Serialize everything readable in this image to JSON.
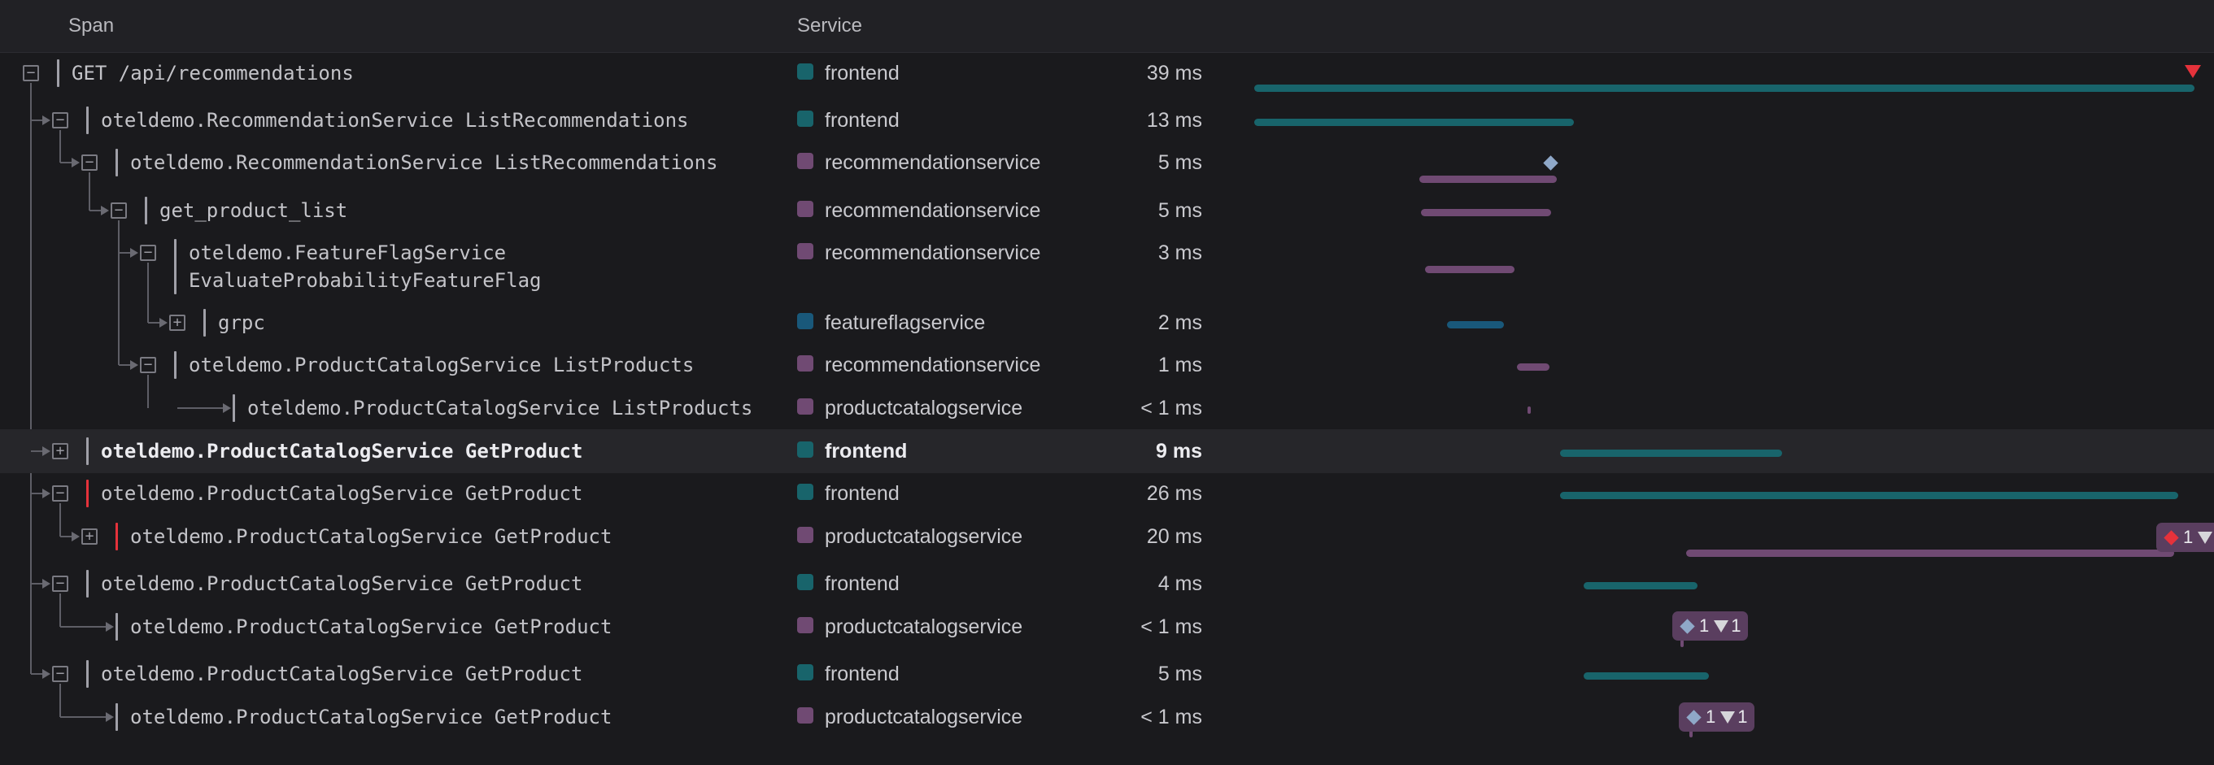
{
  "header": {
    "span_label": "Span",
    "service_label": "Service"
  },
  "colors": {
    "frontend": "#18646b",
    "recommendationservice": "#704a73",
    "featureflagservice": "#19587a",
    "productcatalogservice": "#704a73",
    "error": "#e5323b",
    "event_diamond": "#8fa8c8"
  },
  "rows": [
    {
      "name": "GET /api/recommendations",
      "service": "frontend",
      "duration": "39 ms",
      "expanded": true
    },
    {
      "name": "oteldemo.RecommendationService ListRecommendations",
      "service": "frontend",
      "duration": "13 ms",
      "expanded": true
    },
    {
      "name": "oteldemo.RecommendationService ListRecommendations",
      "service": "recommendationservice",
      "duration": "5 ms",
      "expanded": true
    },
    {
      "name": "get_product_list",
      "service": "recommendationservice",
      "duration": "5 ms",
      "expanded": true
    },
    {
      "name": "oteldemo.FeatureFlagService",
      "name_line2": "EvaluateProbabilityFeatureFlag",
      "service": "recommendationservice",
      "duration": "3 ms",
      "expanded": true
    },
    {
      "name": "grpc",
      "service": "featureflagservice",
      "duration": "2 ms",
      "expanded": false
    },
    {
      "name": "oteldemo.ProductCatalogService ListProducts",
      "service": "recommendationservice",
      "duration": "1 ms",
      "expanded": true
    },
    {
      "name": "oteldemo.ProductCatalogService ListProducts",
      "service": "productcatalogservice",
      "duration": "< 1 ms"
    },
    {
      "name": "oteldemo.ProductCatalogService GetProduct",
      "service": "frontend",
      "duration": "9 ms",
      "expanded": false
    },
    {
      "name": "oteldemo.ProductCatalogService GetProduct",
      "service": "frontend",
      "duration": "26 ms",
      "expanded": true
    },
    {
      "name": "oteldemo.ProductCatalogService GetProduct",
      "service": "productcatalogservice",
      "duration": "20 ms",
      "expanded": false,
      "badge": {
        "diamond_color": "#e5323b",
        "count_1": "1",
        "has_triangle": true
      }
    },
    {
      "name": "oteldemo.ProductCatalogService GetProduct",
      "service": "frontend",
      "duration": "4 ms",
      "expanded": true
    },
    {
      "name": "oteldemo.ProductCatalogService GetProduct",
      "service": "productcatalogservice",
      "duration": "< 1 ms",
      "badge": {
        "diamond_color": "#8fa8c8",
        "count_1": "1",
        "count_2": "1"
      }
    },
    {
      "name": "oteldemo.ProductCatalogService GetProduct",
      "service": "frontend",
      "duration": "5 ms",
      "expanded": true
    },
    {
      "name": "oteldemo.ProductCatalogService GetProduct",
      "service": "productcatalogservice",
      "duration": "< 1 ms",
      "badge": {
        "diamond_color": "#8fa8c8",
        "count_1": "1",
        "count_2": "1"
      }
    }
  ]
}
